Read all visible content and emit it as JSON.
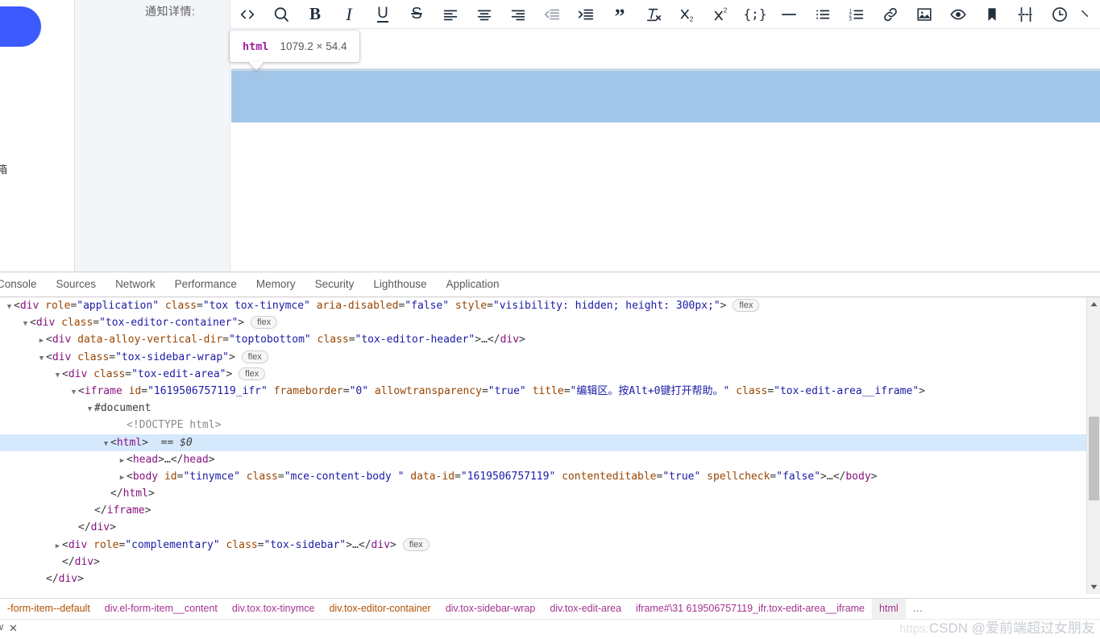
{
  "page": {
    "form_label": "通知详情:",
    "left_fragment": "箱"
  },
  "toolbar": {
    "buttons": [
      {
        "name": "source-code-icon",
        "label": "<>"
      },
      {
        "name": "search-icon",
        "label": "Search"
      },
      {
        "name": "bold-icon",
        "label": "B"
      },
      {
        "name": "italic-icon",
        "label": "I"
      },
      {
        "name": "underline-icon",
        "label": "U"
      },
      {
        "name": "strikethrough-icon",
        "label": "S"
      },
      {
        "name": "align-left-icon",
        "label": "Align left"
      },
      {
        "name": "align-center-icon",
        "label": "Align center"
      },
      {
        "name": "align-right-icon",
        "label": "Align right"
      },
      {
        "name": "outdent-icon",
        "label": "Decrease indent"
      },
      {
        "name": "indent-icon",
        "label": "Increase indent"
      },
      {
        "name": "blockquote-icon",
        "label": "Blockquote"
      },
      {
        "name": "clear-formatting-icon",
        "label": "Clear formatting"
      },
      {
        "name": "subscript-icon",
        "label": "Subscript"
      },
      {
        "name": "superscript-icon",
        "label": "Superscript"
      },
      {
        "name": "code-sample-icon",
        "label": "Code sample"
      },
      {
        "name": "horizontal-rule-icon",
        "label": "Horizontal line"
      },
      {
        "name": "bullet-list-icon",
        "label": "Bullet list"
      },
      {
        "name": "numbered-list-icon",
        "label": "Numbered list"
      },
      {
        "name": "link-icon",
        "label": "Insert link"
      },
      {
        "name": "image-icon",
        "label": "Insert image"
      },
      {
        "name": "preview-icon",
        "label": "Preview"
      },
      {
        "name": "anchor-icon",
        "label": "Anchor"
      },
      {
        "name": "page-break-icon",
        "label": "Page break"
      },
      {
        "name": "insert-datetime-icon",
        "label": "Insert date/time"
      },
      {
        "name": "chevron-more-icon",
        "label": "More"
      }
    ]
  },
  "highlight_tooltip": {
    "tag": "html",
    "dimensions": "1079.2 × 54.4"
  },
  "devtools": {
    "tabs": [
      {
        "name": "tab-console",
        "label": "Console"
      },
      {
        "name": "tab-sources",
        "label": "Sources"
      },
      {
        "name": "tab-network",
        "label": "Network"
      },
      {
        "name": "tab-performance",
        "label": "Performance"
      },
      {
        "name": "tab-memory",
        "label": "Memory"
      },
      {
        "name": "tab-security",
        "label": "Security"
      },
      {
        "name": "tab-lighthouse",
        "label": "Lighthouse"
      },
      {
        "name": "tab-application",
        "label": "Application"
      }
    ],
    "dom_lines": [
      {
        "indent": 0,
        "twist": "open",
        "selected": false,
        "badge": "flex",
        "parts": [
          {
            "c": "pun",
            "t": "<"
          },
          {
            "c": "tag",
            "t": "div"
          },
          {
            "c": "att",
            "t": " role"
          },
          {
            "c": "pun",
            "t": "="
          },
          {
            "c": "val",
            "t": "\"application\""
          },
          {
            "c": "att",
            "t": " class"
          },
          {
            "c": "pun",
            "t": "="
          },
          {
            "c": "val",
            "t": "\"tox tox-tinymce\""
          },
          {
            "c": "att",
            "t": " aria-disabled"
          },
          {
            "c": "pun",
            "t": "="
          },
          {
            "c": "val",
            "t": "\"false\""
          },
          {
            "c": "att",
            "t": " style"
          },
          {
            "c": "pun",
            "t": "="
          },
          {
            "c": "val",
            "t": "\"visibility: hidden; height: 300px;\""
          },
          {
            "c": "pun",
            "t": ">"
          }
        ]
      },
      {
        "indent": 1,
        "twist": "open",
        "selected": false,
        "badge": "flex",
        "parts": [
          {
            "c": "pun",
            "t": "<"
          },
          {
            "c": "tag",
            "t": "div"
          },
          {
            "c": "att",
            "t": " class"
          },
          {
            "c": "pun",
            "t": "="
          },
          {
            "c": "val",
            "t": "\"tox-editor-container\""
          },
          {
            "c": "pun",
            "t": ">"
          }
        ]
      },
      {
        "indent": 2,
        "twist": "closed",
        "selected": false,
        "badge": "",
        "parts": [
          {
            "c": "pun",
            "t": "<"
          },
          {
            "c": "tag",
            "t": "div"
          },
          {
            "c": "att",
            "t": " data-alloy-vertical-dir"
          },
          {
            "c": "pun",
            "t": "="
          },
          {
            "c": "val",
            "t": "\"toptobottom\""
          },
          {
            "c": "att",
            "t": " class"
          },
          {
            "c": "pun",
            "t": "="
          },
          {
            "c": "val",
            "t": "\"tox-editor-header\""
          },
          {
            "c": "pun",
            "t": ">"
          },
          {
            "c": "txt",
            "t": "…"
          },
          {
            "c": "pun",
            "t": "</"
          },
          {
            "c": "tag",
            "t": "div"
          },
          {
            "c": "pun",
            "t": ">"
          }
        ]
      },
      {
        "indent": 2,
        "twist": "open",
        "selected": false,
        "badge": "flex",
        "parts": [
          {
            "c": "pun",
            "t": "<"
          },
          {
            "c": "tag",
            "t": "div"
          },
          {
            "c": "att",
            "t": " class"
          },
          {
            "c": "pun",
            "t": "="
          },
          {
            "c": "val",
            "t": "\"tox-sidebar-wrap\""
          },
          {
            "c": "pun",
            "t": ">"
          }
        ]
      },
      {
        "indent": 3,
        "twist": "open",
        "selected": false,
        "badge": "flex",
        "parts": [
          {
            "c": "pun",
            "t": "<"
          },
          {
            "c": "tag",
            "t": "div"
          },
          {
            "c": "att",
            "t": " class"
          },
          {
            "c": "pun",
            "t": "="
          },
          {
            "c": "val",
            "t": "\"tox-edit-area\""
          },
          {
            "c": "pun",
            "t": ">"
          }
        ]
      },
      {
        "indent": 4,
        "twist": "open",
        "selected": false,
        "badge": "",
        "parts": [
          {
            "c": "pun",
            "t": "<"
          },
          {
            "c": "tag",
            "t": "iframe"
          },
          {
            "c": "att",
            "t": " id"
          },
          {
            "c": "pun",
            "t": "="
          },
          {
            "c": "val",
            "t": "\"1619506757119_ifr\""
          },
          {
            "c": "att",
            "t": " frameborder"
          },
          {
            "c": "pun",
            "t": "="
          },
          {
            "c": "val",
            "t": "\"0\""
          },
          {
            "c": "att",
            "t": " allowtransparency"
          },
          {
            "c": "pun",
            "t": "="
          },
          {
            "c": "val",
            "t": "\"true\""
          },
          {
            "c": "att",
            "t": " title"
          },
          {
            "c": "pun",
            "t": "="
          },
          {
            "c": "val",
            "t": "\"编辑区。按Alt+0键打开帮助。\""
          },
          {
            "c": "att",
            "t": " class"
          },
          {
            "c": "pun",
            "t": "="
          },
          {
            "c": "val",
            "t": "\"tox-edit-area__iframe\""
          },
          {
            "c": "pun",
            "t": ">"
          }
        ]
      },
      {
        "indent": 5,
        "twist": "open",
        "selected": false,
        "badge": "",
        "parts": [
          {
            "c": "txt",
            "t": "#document"
          }
        ]
      },
      {
        "indent": 7,
        "twist": "none",
        "selected": false,
        "badge": "",
        "parts": [
          {
            "c": "doct",
            "t": "<!DOCTYPE html>"
          }
        ]
      },
      {
        "indent": 6,
        "twist": "open",
        "selected": true,
        "badge": "",
        "parts": [
          {
            "c": "pun",
            "t": "<"
          },
          {
            "c": "tag",
            "t": "html"
          },
          {
            "c": "pun",
            "t": ">"
          },
          {
            "c": "txt",
            "t": "  == "
          },
          {
            "c": "dollar",
            "t": "$0"
          }
        ]
      },
      {
        "indent": 7,
        "twist": "closed",
        "selected": false,
        "badge": "",
        "parts": [
          {
            "c": "pun",
            "t": "<"
          },
          {
            "c": "tag",
            "t": "head"
          },
          {
            "c": "pun",
            "t": ">"
          },
          {
            "c": "txt",
            "t": "…"
          },
          {
            "c": "pun",
            "t": "</"
          },
          {
            "c": "tag",
            "t": "head"
          },
          {
            "c": "pun",
            "t": ">"
          }
        ]
      },
      {
        "indent": 7,
        "twist": "closed",
        "selected": false,
        "badge": "",
        "parts": [
          {
            "c": "pun",
            "t": "<"
          },
          {
            "c": "tag",
            "t": "body"
          },
          {
            "c": "att",
            "t": " id"
          },
          {
            "c": "pun",
            "t": "="
          },
          {
            "c": "val",
            "t": "\"tinymce\""
          },
          {
            "c": "att",
            "t": " class"
          },
          {
            "c": "pun",
            "t": "="
          },
          {
            "c": "val",
            "t": "\"mce-content-body \""
          },
          {
            "c": "att",
            "t": " data-id"
          },
          {
            "c": "pun",
            "t": "="
          },
          {
            "c": "val",
            "t": "\"1619506757119\""
          },
          {
            "c": "att",
            "t": " contenteditable"
          },
          {
            "c": "pun",
            "t": "="
          },
          {
            "c": "val",
            "t": "\"true\""
          },
          {
            "c": "att",
            "t": " spellcheck"
          },
          {
            "c": "pun",
            "t": "="
          },
          {
            "c": "val",
            "t": "\"false\""
          },
          {
            "c": "pun",
            "t": ">"
          },
          {
            "c": "txt",
            "t": "…"
          },
          {
            "c": "pun",
            "t": "</"
          },
          {
            "c": "tag",
            "t": "body"
          },
          {
            "c": "pun",
            "t": ">"
          }
        ]
      },
      {
        "indent": 6,
        "twist": "none",
        "selected": false,
        "badge": "",
        "parts": [
          {
            "c": "pun",
            "t": "</"
          },
          {
            "c": "tag",
            "t": "html"
          },
          {
            "c": "pun",
            "t": ">"
          }
        ]
      },
      {
        "indent": 5,
        "twist": "none",
        "selected": false,
        "badge": "",
        "parts": [
          {
            "c": "pun",
            "t": "</"
          },
          {
            "c": "tag",
            "t": "iframe"
          },
          {
            "c": "pun",
            "t": ">"
          }
        ]
      },
      {
        "indent": 4,
        "twist": "none",
        "selected": false,
        "badge": "",
        "parts": [
          {
            "c": "pun",
            "t": "</"
          },
          {
            "c": "tag",
            "t": "div"
          },
          {
            "c": "pun",
            "t": ">"
          }
        ]
      },
      {
        "indent": 3,
        "twist": "closed",
        "selected": false,
        "badge": "flex",
        "parts": [
          {
            "c": "pun",
            "t": "<"
          },
          {
            "c": "tag",
            "t": "div"
          },
          {
            "c": "att",
            "t": " role"
          },
          {
            "c": "pun",
            "t": "="
          },
          {
            "c": "val",
            "t": "\"complementary\""
          },
          {
            "c": "att",
            "t": " class"
          },
          {
            "c": "pun",
            "t": "="
          },
          {
            "c": "val",
            "t": "\"tox-sidebar\""
          },
          {
            "c": "pun",
            "t": ">"
          },
          {
            "c": "txt",
            "t": "…"
          },
          {
            "c": "pun",
            "t": "</"
          },
          {
            "c": "tag",
            "t": "div"
          },
          {
            "c": "pun",
            "t": ">"
          }
        ]
      },
      {
        "indent": 3,
        "twist": "none",
        "selected": false,
        "badge": "",
        "parts": [
          {
            "c": "pun",
            "t": "</"
          },
          {
            "c": "tag",
            "t": "div"
          },
          {
            "c": "pun",
            "t": ">"
          }
        ]
      },
      {
        "indent": 2,
        "twist": "none",
        "selected": false,
        "badge": "",
        "parts": [
          {
            "c": "pun",
            "t": "</"
          },
          {
            "c": "tag",
            "t": "div"
          },
          {
            "c": "pun",
            "t": ">"
          }
        ]
      }
    ],
    "breadcrumbs": [
      {
        "name": "crumb-form-item-default",
        "label": "-form-item--default",
        "style": "orange"
      },
      {
        "name": "crumb-el-form-item-content",
        "label": "div.el-form-item__content",
        "style": "pink"
      },
      {
        "name": "crumb-tox-tinymce",
        "label": "div.tox.tox-tinymce",
        "style": "pink"
      },
      {
        "name": "crumb-tox-editor-container",
        "label": "div.tox-editor-container",
        "style": "orange"
      },
      {
        "name": "crumb-tox-sidebar-wrap",
        "label": "div.tox-sidebar-wrap",
        "style": "pink"
      },
      {
        "name": "crumb-tox-edit-area",
        "label": "div.tox-edit-area",
        "style": "pink"
      },
      {
        "name": "crumb-iframe",
        "label": "iframe#\\31 619506757119_ifr.tox-edit-area__iframe",
        "style": "pink"
      },
      {
        "name": "crumb-html",
        "label": "html",
        "style": "sel"
      },
      {
        "name": "crumb-overflow",
        "label": "…",
        "style": "ell"
      }
    ],
    "status": {
      "left_text": "w",
      "close": "✕"
    }
  },
  "watermark": {
    "url": "https:",
    "text": "CSDN @爱前端超过女朋友"
  }
}
